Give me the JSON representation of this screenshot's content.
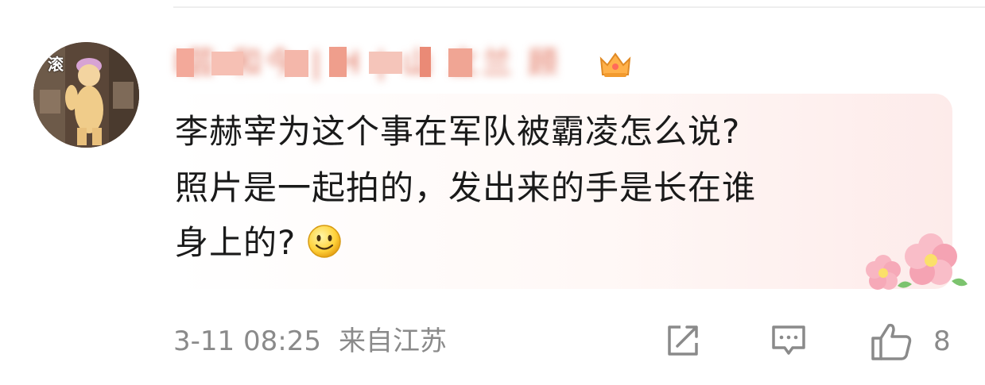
{
  "comment": {
    "avatar_tag": "滚",
    "username": "I芸  和今 | H | 山 立兰 顾",
    "text_lines": [
      "李赫宰为这个事在军队被霸凌怎么说?",
      "照片是一起拍的，发出来的手是长在谁",
      "身上的?"
    ],
    "emoji": "smiley-face-icon",
    "timestamp": "3-11 08:25",
    "location": "来自江苏",
    "like_count": "8",
    "decoration": "cherry-blossom-icon",
    "badge": "vip-crown-icon"
  },
  "colors": {
    "username": "#e06f58",
    "meta_text": "#8a8a8a",
    "bubble_tint": "#fdebea",
    "text": "#1a1a1a"
  }
}
